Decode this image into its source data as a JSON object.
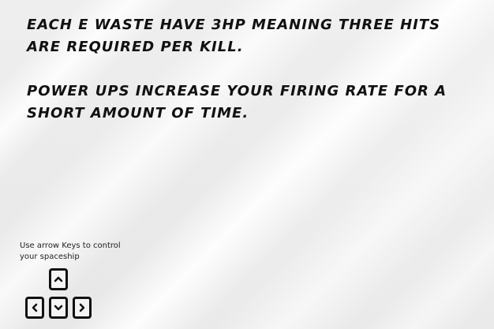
{
  "messages": {
    "line1": "Each E waste have 3hp meaning three hits are required per kill.",
    "line2": "Power ups increase your firing rate for a short amount of time."
  },
  "controls": {
    "hint": "Use arrow Keys to control your spaceship"
  },
  "icons": {
    "up": "arrow-up-icon",
    "left": "arrow-left-icon",
    "down": "arrow-down-icon",
    "right": "arrow-right-icon"
  }
}
